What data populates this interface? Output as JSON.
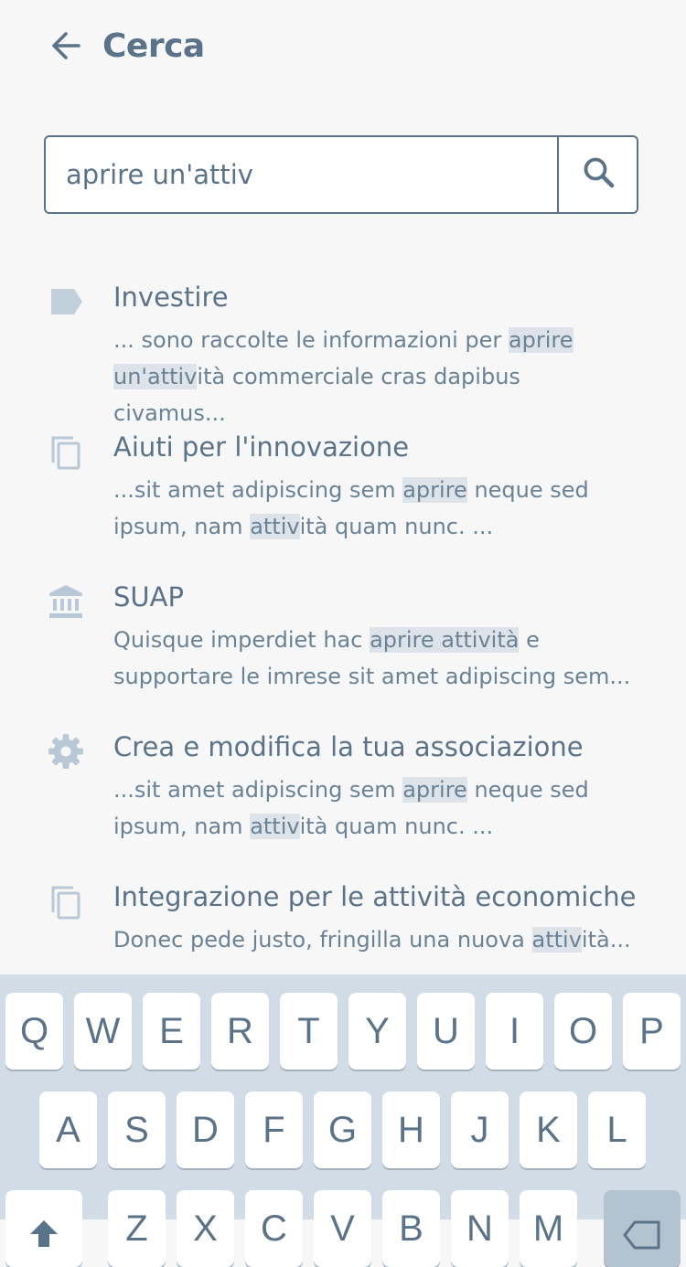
{
  "header": {
    "title": "Cerca",
    "back_icon": "arrow-left-icon"
  },
  "search": {
    "value": "aprire un'attiv",
    "icon": "search-icon"
  },
  "results": [
    {
      "icon": "tag-icon",
      "title": "Investire",
      "snippet_lines": [
        [
          {
            "t": "... sono raccolte le informazioni per "
          },
          {
            "t": "aprire",
            "hl": true
          }
        ],
        [
          {
            "t": "un'attiv",
            "hl": true
          },
          {
            "t": "ità commerciale cras dapibus civamus..."
          }
        ]
      ]
    },
    {
      "icon": "copy-icon",
      "title": "Aiuti per l'innovazione",
      "snippet_lines": [
        [
          {
            "t": "...sit amet adipiscing sem "
          },
          {
            "t": "aprire",
            "hl": true
          },
          {
            "t": " neque sed"
          }
        ],
        [
          {
            "t": "ipsum, nam "
          },
          {
            "t": "attiv",
            "hl": true
          },
          {
            "t": "ità quam nunc. ..."
          }
        ]
      ]
    },
    {
      "icon": "bank-icon",
      "title": "SUAP",
      "snippet_lines": [
        [
          {
            "t": "Quisque imperdiet hac "
          },
          {
            "t": "aprire attività",
            "hl": true
          },
          {
            "t": " e"
          }
        ],
        [
          {
            "t": "supportare le imrese sit amet adipiscing sem..."
          }
        ]
      ]
    },
    {
      "icon": "gear-icon",
      "title": "Crea e modifica la tua associazione",
      "snippet_lines": [
        [
          {
            "t": "...sit amet adipiscing sem "
          },
          {
            "t": "aprire",
            "hl": true
          },
          {
            "t": " neque sed"
          }
        ],
        [
          {
            "t": "ipsum, nam "
          },
          {
            "t": "attiv",
            "hl": true
          },
          {
            "t": "ità quam nunc. ..."
          }
        ]
      ]
    },
    {
      "icon": "copy-icon",
      "title": "Integrazione per le attività economiche",
      "snippet_lines": [
        [
          {
            "t": "Donec pede justo, fringilla una nuova "
          },
          {
            "t": "attiv",
            "hl": true
          },
          {
            "t": "ità..."
          }
        ]
      ]
    }
  ],
  "keyboard": {
    "row1": [
      "Q",
      "W",
      "E",
      "R",
      "T",
      "Y",
      "U",
      "I",
      "O",
      "P"
    ],
    "row2": [
      "A",
      "S",
      "D",
      "F",
      "G",
      "H",
      "J",
      "K",
      "L"
    ],
    "row3": [
      "Z",
      "X",
      "C",
      "V",
      "B",
      "N",
      "M"
    ],
    "shift_icon": "shift-icon",
    "backspace_icon": "backspace-icon"
  },
  "colors": {
    "primary": "#5b7389",
    "icon": "#b9c8d6",
    "highlight": "#dde3e9",
    "keyboard_bg": "#d1dce6"
  }
}
